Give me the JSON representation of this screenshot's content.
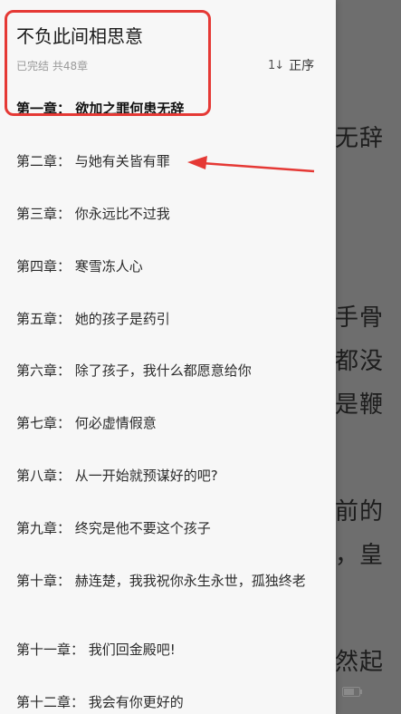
{
  "reader": {
    "fragments": [
      {
        "text": "无辞"
      },
      {
        "text": "手骨"
      },
      {
        "text": "都没"
      },
      {
        "text": "是鞭"
      },
      {
        "text": "前的"
      },
      {
        "text": "，皇"
      },
      {
        "text": "然起"
      }
    ],
    "status_page": "5"
  },
  "book": {
    "title": "不负此间相思意",
    "meta": "已完结 共48章",
    "sort_label": "正序",
    "sort_icon": "1↓"
  },
  "chapters": [
    {
      "label": "第一章：  欲加之罪何患无辞",
      "current": true
    },
    {
      "label": "第二章：  与她有关皆有罪"
    },
    {
      "label": "第三章：  你永远比不过我"
    },
    {
      "label": "第四章：  寒雪冻人心"
    },
    {
      "label": "第五章：  她的孩子是药引"
    },
    {
      "label": "第六章：  除了孩子，我什么都愿意给你"
    },
    {
      "label": "第七章：  何必虚情假意"
    },
    {
      "label": "第八章：  从一开始就预谋好的吧?"
    },
    {
      "label": "第九章：  终究是他不要这个孩子"
    },
    {
      "label": "第十章：  赫连楚，我我祝你永生永世，孤独终老"
    },
    {
      "label": "第十一章：  我们回金殿吧!"
    },
    {
      "label": "第十二章：  我会有你更好的"
    }
  ],
  "colors": {
    "annotation": "#e53935",
    "drawer_bg": "#f7f7f7",
    "overlay": "#6e6e6e"
  },
  "battery_level": 0.7
}
